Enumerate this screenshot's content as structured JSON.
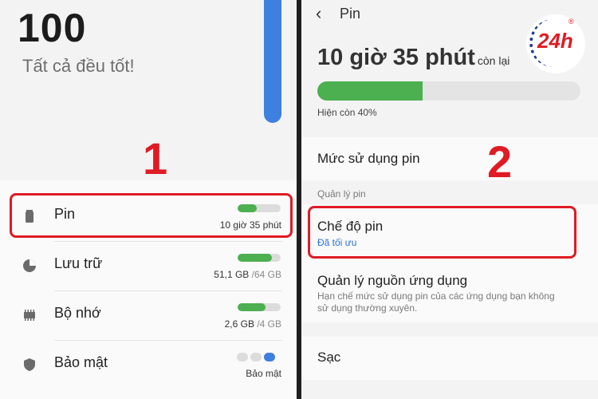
{
  "left": {
    "score": "100",
    "status": "Tất cả đều tốt!",
    "step_label": "1",
    "items": [
      {
        "label": "Pin",
        "value": "10 giờ 35 phút",
        "value_muted": "",
        "icon": "battery-icon",
        "level": 0.45
      },
      {
        "label": "Lưu trữ",
        "value": "51,1 GB",
        "value_muted": " /64 GB",
        "icon": "storage-pie-icon",
        "level": 0.8
      },
      {
        "label": "Bộ nhớ",
        "value": "2,6 GB",
        "value_muted": " /4 GB",
        "icon": "memory-chip-icon",
        "level": 0.65
      },
      {
        "label": "Bảo mật",
        "value": "Bảo mật",
        "value_muted": "",
        "icon": "shield-icon",
        "level": 1.0
      }
    ]
  },
  "right": {
    "back_icon": "chevron-left-icon",
    "title": "Pin",
    "time_big": "10 giờ 35 phút",
    "time_suffix": "còn lại",
    "battery_level": 0.4,
    "battery_caption": "Hiện còn 40%",
    "usage_label": "Mức sử dụng pin",
    "section_header": "Quản lý pin",
    "mode_title": "Chế độ pin",
    "mode_value": "Đã tối ưu",
    "apps_title": "Quản lý nguồn ứng dụng",
    "apps_desc": "Hạn chế mức sử dụng pin của các ứng dụng bạn không sử dụng thường xuyên.",
    "charge_label": "Sạc",
    "step_label": "2",
    "logo_text": "24h",
    "logo_reg": "®"
  },
  "colors": {
    "accent_red": "#e01b24",
    "green": "#4caf50",
    "blue": "#3f7fe0",
    "link_blue": "#2b6fd6"
  }
}
